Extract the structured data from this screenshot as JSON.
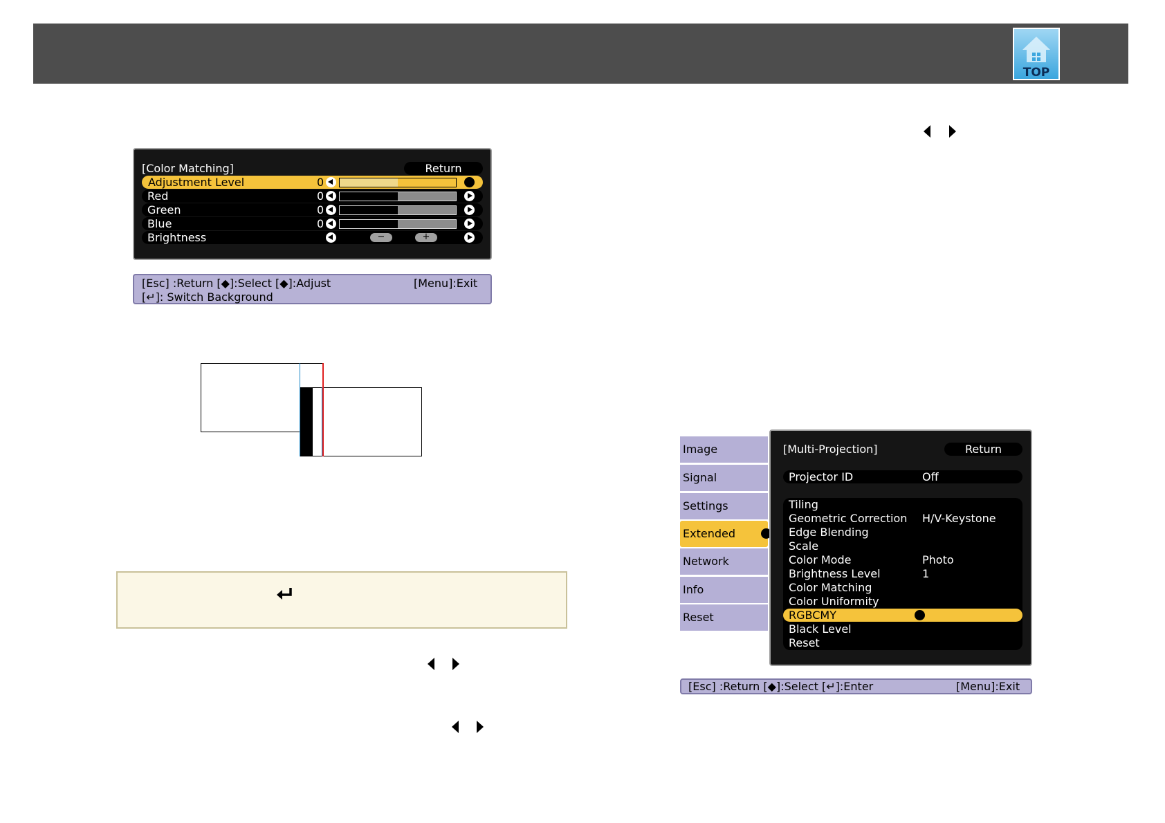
{
  "header": {
    "top_label": "TOP"
  },
  "color_matching_menu": {
    "title": "[Color Matching]",
    "return_label": "Return",
    "rows": [
      {
        "label": "Adjustment Level",
        "value": "0",
        "level": 0.5
      },
      {
        "label": "Red",
        "value": "0",
        "level": 0.5
      },
      {
        "label": "Green",
        "value": "0",
        "level": 0.5
      },
      {
        "label": "Blue",
        "value": "0",
        "level": 0.5
      },
      {
        "label": "Brightness"
      }
    ]
  },
  "color_matching_help": {
    "line1_left": "[Esc] :Return  [◆]:Select  [◆]:Adjust",
    "line1_right": "[Menu]:Exit",
    "line2": "[↵]: Switch Background"
  },
  "extended_menu": {
    "tabs": [
      "Image",
      "Signal",
      "Settings",
      "Extended",
      "Network",
      "Info",
      "Reset"
    ],
    "selected_tab": "Extended",
    "title": "[Multi-Projection]",
    "return_label": "Return",
    "projector_id": {
      "label": "Projector ID",
      "value": "Off"
    },
    "items": [
      {
        "label": "Tiling",
        "value": ""
      },
      {
        "label": "Geometric Correction",
        "value": "H/V-Keystone"
      },
      {
        "label": "Edge Blending",
        "value": ""
      },
      {
        "label": "Scale",
        "value": ""
      },
      {
        "label": "Color Mode",
        "value": "Photo"
      },
      {
        "label": "Brightness Level",
        "value": "1"
      },
      {
        "label": "Color Matching",
        "value": ""
      },
      {
        "label": "Color Uniformity",
        "value": ""
      },
      {
        "label": "RGBCMY",
        "value": ""
      },
      {
        "label": "Black Level",
        "value": ""
      },
      {
        "label": "Reset",
        "value": ""
      }
    ],
    "selected_item": "RGBCMY"
  },
  "extended_help": {
    "left": "[Esc] :Return  [◆]:Select  [↵]:Enter",
    "right": "[Menu]:Exit"
  },
  "colors": {
    "header": "#4d4d4d",
    "highlight": "#f5c33b",
    "help_bar": "#b7b2d6",
    "note_bg": "#fbf7e6"
  }
}
